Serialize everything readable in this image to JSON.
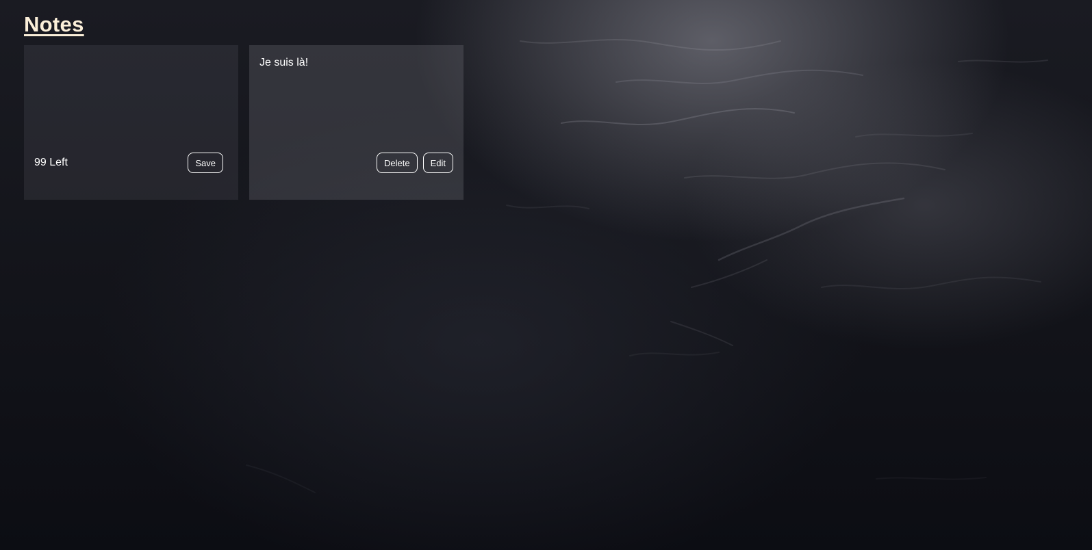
{
  "header": {
    "title": "Notes"
  },
  "new_note": {
    "text_value": "",
    "chars_left": "99 Left",
    "save_label": "Save"
  },
  "notes": [
    {
      "text": "Je suis là!",
      "delete_label": "Delete",
      "edit_label": "Edit"
    }
  ]
}
